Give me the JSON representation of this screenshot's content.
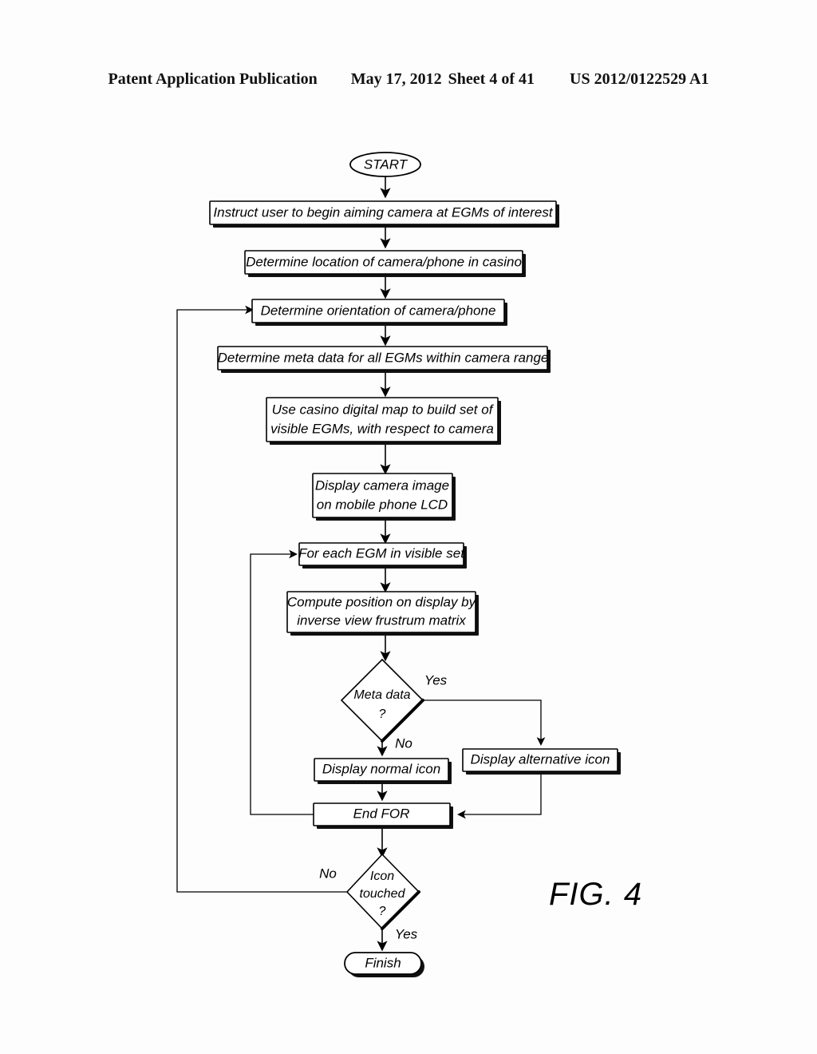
{
  "header": {
    "publication": "Patent Application Publication",
    "date": "May 17, 2012",
    "sheet": "Sheet 4 of 41",
    "number": "US 2012/0122529 A1"
  },
  "figure": {
    "label": "FIG. 4",
    "caption_position": "bottom-right"
  },
  "flowchart": {
    "type": "flowchart",
    "orientation": "top-to-bottom",
    "nodes": [
      {
        "id": "start",
        "shape": "ellipse",
        "label": "START"
      },
      {
        "id": "instruct",
        "shape": "process",
        "label": "Instruct user to begin aiming camera at EGMs of interest"
      },
      {
        "id": "loc",
        "shape": "process",
        "label": "Determine location of camera/phone in casino"
      },
      {
        "id": "orient",
        "shape": "process",
        "label": "Determine orientation of camera/phone"
      },
      {
        "id": "meta",
        "shape": "process",
        "label": "Determine meta data for all EGMs within camera range"
      },
      {
        "id": "map",
        "shape": "process",
        "label_line1": "Use casino digital map to build set of",
        "label_line2": "visible EGMs, with respect to camera"
      },
      {
        "id": "display",
        "shape": "process",
        "label_line1": "Display camera image",
        "label_line2": "on mobile phone LCD"
      },
      {
        "id": "foreach",
        "shape": "process",
        "label": "For each EGM in visible set"
      },
      {
        "id": "compute",
        "shape": "process",
        "label_line1": "Compute position on display by",
        "label_line2": "inverse view frustrum matrix"
      },
      {
        "id": "metaq",
        "shape": "decision",
        "label_line1": "Meta data",
        "label_line2": "?"
      },
      {
        "id": "normal",
        "shape": "process",
        "label": "Display normal icon"
      },
      {
        "id": "alt",
        "shape": "process",
        "label": "Display alternative icon"
      },
      {
        "id": "endfor",
        "shape": "process",
        "label": "End FOR"
      },
      {
        "id": "touchq",
        "shape": "decision",
        "label_line1": "Icon",
        "label_line2": "touched",
        "label_line3": "?"
      },
      {
        "id": "finish",
        "shape": "terminator",
        "label": "Finish"
      }
    ],
    "edge_labels": {
      "meta_yes": "Yes",
      "meta_no": "No",
      "touch_no": "No",
      "touch_yes": "Yes"
    },
    "edges": [
      {
        "from": "start",
        "to": "instruct"
      },
      {
        "from": "instruct",
        "to": "loc"
      },
      {
        "from": "loc",
        "to": "orient"
      },
      {
        "from": "orient",
        "to": "meta"
      },
      {
        "from": "meta",
        "to": "map"
      },
      {
        "from": "map",
        "to": "display"
      },
      {
        "from": "display",
        "to": "foreach"
      },
      {
        "from": "foreach",
        "to": "compute"
      },
      {
        "from": "compute",
        "to": "metaq"
      },
      {
        "from": "metaq",
        "to": "alt",
        "label": "Yes"
      },
      {
        "from": "metaq",
        "to": "normal",
        "label": "No"
      },
      {
        "from": "normal",
        "to": "endfor"
      },
      {
        "from": "alt",
        "to": "endfor"
      },
      {
        "from": "endfor",
        "to": "foreach",
        "kind": "loop-back"
      },
      {
        "from": "endfor",
        "to": "touchq"
      },
      {
        "from": "touchq",
        "to": "orient",
        "label": "No",
        "kind": "loop-back"
      },
      {
        "from": "touchq",
        "to": "finish",
        "label": "Yes"
      }
    ]
  },
  "colors": {
    "ink": "#000000",
    "paper": "#ffffff"
  }
}
